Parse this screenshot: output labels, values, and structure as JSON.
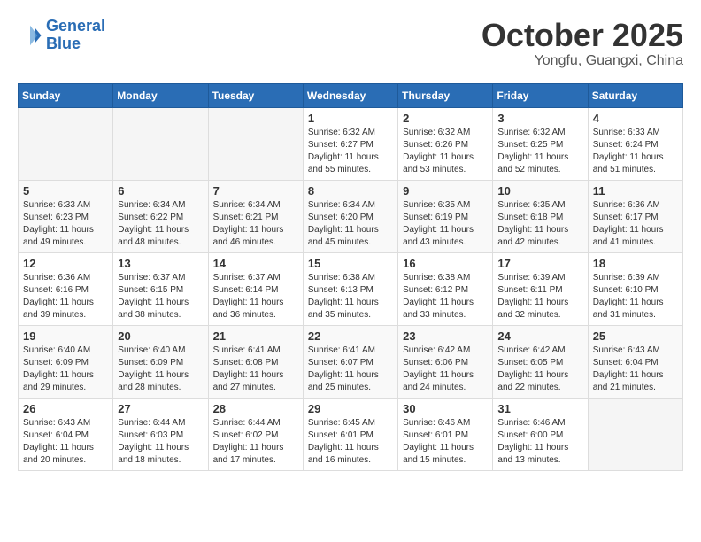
{
  "header": {
    "logo_line1": "General",
    "logo_line2": "Blue",
    "month": "October 2025",
    "location": "Yongfu, Guangxi, China"
  },
  "weekdays": [
    "Sunday",
    "Monday",
    "Tuesday",
    "Wednesday",
    "Thursday",
    "Friday",
    "Saturday"
  ],
  "weeks": [
    [
      {
        "day": "",
        "info": ""
      },
      {
        "day": "",
        "info": ""
      },
      {
        "day": "",
        "info": ""
      },
      {
        "day": "1",
        "info": "Sunrise: 6:32 AM\nSunset: 6:27 PM\nDaylight: 11 hours\nand 55 minutes."
      },
      {
        "day": "2",
        "info": "Sunrise: 6:32 AM\nSunset: 6:26 PM\nDaylight: 11 hours\nand 53 minutes."
      },
      {
        "day": "3",
        "info": "Sunrise: 6:32 AM\nSunset: 6:25 PM\nDaylight: 11 hours\nand 52 minutes."
      },
      {
        "day": "4",
        "info": "Sunrise: 6:33 AM\nSunset: 6:24 PM\nDaylight: 11 hours\nand 51 minutes."
      }
    ],
    [
      {
        "day": "5",
        "info": "Sunrise: 6:33 AM\nSunset: 6:23 PM\nDaylight: 11 hours\nand 49 minutes."
      },
      {
        "day": "6",
        "info": "Sunrise: 6:34 AM\nSunset: 6:22 PM\nDaylight: 11 hours\nand 48 minutes."
      },
      {
        "day": "7",
        "info": "Sunrise: 6:34 AM\nSunset: 6:21 PM\nDaylight: 11 hours\nand 46 minutes."
      },
      {
        "day": "8",
        "info": "Sunrise: 6:34 AM\nSunset: 6:20 PM\nDaylight: 11 hours\nand 45 minutes."
      },
      {
        "day": "9",
        "info": "Sunrise: 6:35 AM\nSunset: 6:19 PM\nDaylight: 11 hours\nand 43 minutes."
      },
      {
        "day": "10",
        "info": "Sunrise: 6:35 AM\nSunset: 6:18 PM\nDaylight: 11 hours\nand 42 minutes."
      },
      {
        "day": "11",
        "info": "Sunrise: 6:36 AM\nSunset: 6:17 PM\nDaylight: 11 hours\nand 41 minutes."
      }
    ],
    [
      {
        "day": "12",
        "info": "Sunrise: 6:36 AM\nSunset: 6:16 PM\nDaylight: 11 hours\nand 39 minutes."
      },
      {
        "day": "13",
        "info": "Sunrise: 6:37 AM\nSunset: 6:15 PM\nDaylight: 11 hours\nand 38 minutes."
      },
      {
        "day": "14",
        "info": "Sunrise: 6:37 AM\nSunset: 6:14 PM\nDaylight: 11 hours\nand 36 minutes."
      },
      {
        "day": "15",
        "info": "Sunrise: 6:38 AM\nSunset: 6:13 PM\nDaylight: 11 hours\nand 35 minutes."
      },
      {
        "day": "16",
        "info": "Sunrise: 6:38 AM\nSunset: 6:12 PM\nDaylight: 11 hours\nand 33 minutes."
      },
      {
        "day": "17",
        "info": "Sunrise: 6:39 AM\nSunset: 6:11 PM\nDaylight: 11 hours\nand 32 minutes."
      },
      {
        "day": "18",
        "info": "Sunrise: 6:39 AM\nSunset: 6:10 PM\nDaylight: 11 hours\nand 31 minutes."
      }
    ],
    [
      {
        "day": "19",
        "info": "Sunrise: 6:40 AM\nSunset: 6:09 PM\nDaylight: 11 hours\nand 29 minutes."
      },
      {
        "day": "20",
        "info": "Sunrise: 6:40 AM\nSunset: 6:09 PM\nDaylight: 11 hours\nand 28 minutes."
      },
      {
        "day": "21",
        "info": "Sunrise: 6:41 AM\nSunset: 6:08 PM\nDaylight: 11 hours\nand 27 minutes."
      },
      {
        "day": "22",
        "info": "Sunrise: 6:41 AM\nSunset: 6:07 PM\nDaylight: 11 hours\nand 25 minutes."
      },
      {
        "day": "23",
        "info": "Sunrise: 6:42 AM\nSunset: 6:06 PM\nDaylight: 11 hours\nand 24 minutes."
      },
      {
        "day": "24",
        "info": "Sunrise: 6:42 AM\nSunset: 6:05 PM\nDaylight: 11 hours\nand 22 minutes."
      },
      {
        "day": "25",
        "info": "Sunrise: 6:43 AM\nSunset: 6:04 PM\nDaylight: 11 hours\nand 21 minutes."
      }
    ],
    [
      {
        "day": "26",
        "info": "Sunrise: 6:43 AM\nSunset: 6:04 PM\nDaylight: 11 hours\nand 20 minutes."
      },
      {
        "day": "27",
        "info": "Sunrise: 6:44 AM\nSunset: 6:03 PM\nDaylight: 11 hours\nand 18 minutes."
      },
      {
        "day": "28",
        "info": "Sunrise: 6:44 AM\nSunset: 6:02 PM\nDaylight: 11 hours\nand 17 minutes."
      },
      {
        "day": "29",
        "info": "Sunrise: 6:45 AM\nSunset: 6:01 PM\nDaylight: 11 hours\nand 16 minutes."
      },
      {
        "day": "30",
        "info": "Sunrise: 6:46 AM\nSunset: 6:01 PM\nDaylight: 11 hours\nand 15 minutes."
      },
      {
        "day": "31",
        "info": "Sunrise: 6:46 AM\nSunset: 6:00 PM\nDaylight: 11 hours\nand 13 minutes."
      },
      {
        "day": "",
        "info": ""
      }
    ]
  ]
}
